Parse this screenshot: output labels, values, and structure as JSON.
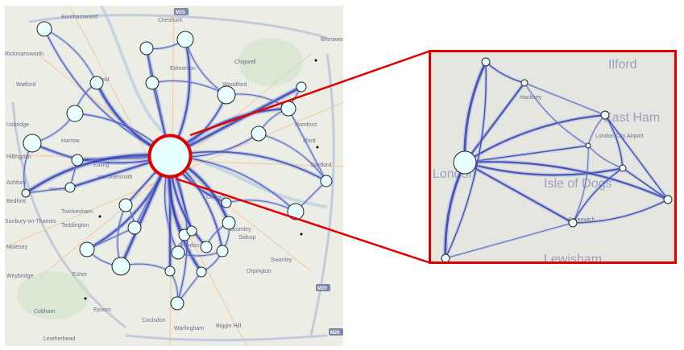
{
  "colors": {
    "edge": "#2a35a8",
    "edge_light": "#8da0e0",
    "node_fill": "#e8ffff",
    "node_stroke": "#222222",
    "highlight": "#e00000",
    "map_bg": "#eceee6",
    "road": "#f2c28a",
    "motorway": "#b8c0d8",
    "water": "#b8cde0",
    "park": "#cfe3c4"
  },
  "main_map": {
    "place_labels": [
      "Borehamwood",
      "Rickmansworth",
      "Cheshunt",
      "Chigwell",
      "Brentwood",
      "Enfield",
      "Edmonton",
      "Woodford",
      "Watford",
      "Uxbridge",
      "Hillingdon",
      "Harrow",
      "Romford",
      "Ilford",
      "Hounslow",
      "Bedfont",
      "Twickenham",
      "Teddington",
      "Molesey",
      "Esher",
      "Weybridge",
      "Epsom",
      "Coulsdon",
      "Warlingham",
      "Biggin Hill",
      "Sidcup",
      "Orpington",
      "Swanley",
      "Leatherhead",
      "Cobham",
      "Sunbury-on-Thames",
      "Ashford",
      "Croydon",
      "Bromley",
      "Dartford",
      "Ealing",
      "Hammersmith",
      "Catford"
    ],
    "road_labels": [
      "M25",
      "M20",
      "M26"
    ]
  },
  "inset_map": {
    "place_labels": [
      "Ilford",
      "Hackney",
      "East Ham",
      "London City Airport",
      "London",
      "Isle of Dogs",
      "Greenwich",
      "Lewisham"
    ]
  }
}
